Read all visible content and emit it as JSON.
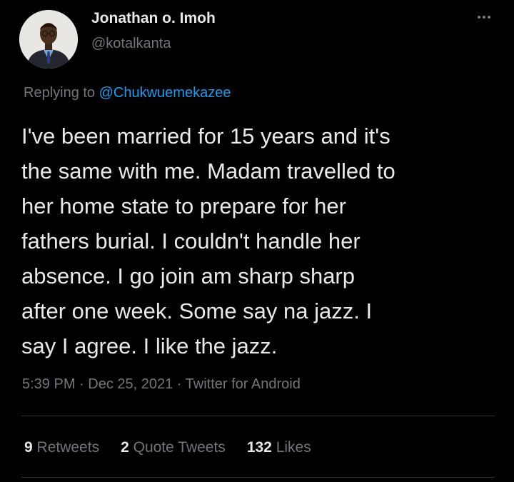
{
  "author": {
    "display_name": "Jonathan o. Imoh",
    "handle": "@kotalkanta",
    "avatar_icon": "profile-photo"
  },
  "reply": {
    "prefix": "Replying to ",
    "mention": "@Chukwuemekazee"
  },
  "tweet": {
    "lines": [
      "I've been married for 15 years and it's",
      "the same with me. Madam travelled to",
      "her home state to prepare for her",
      "fathers burial. I couldn't handle her",
      "absence. I go join am sharp sharp",
      "after one week. Some say na jazz. I",
      "say I agree. I like the jazz."
    ]
  },
  "meta": {
    "time": "5:39 PM",
    "sep1": " · ",
    "date": "Dec 25, 2021",
    "sep2": " · ",
    "source": "Twitter for Android"
  },
  "stats": {
    "retweets": {
      "count": "9",
      "label": "Retweets"
    },
    "quotes": {
      "count": "2",
      "label": "Quote Tweets"
    },
    "likes": {
      "count": "132",
      "label": "Likes"
    }
  },
  "colors": {
    "background": "#000000",
    "text_primary": "#e7e9ea",
    "text_secondary": "#71767b",
    "accent": "#1d9bf0",
    "divider": "#2f3336"
  },
  "icons": {
    "more": "more-horizontal-icon"
  }
}
